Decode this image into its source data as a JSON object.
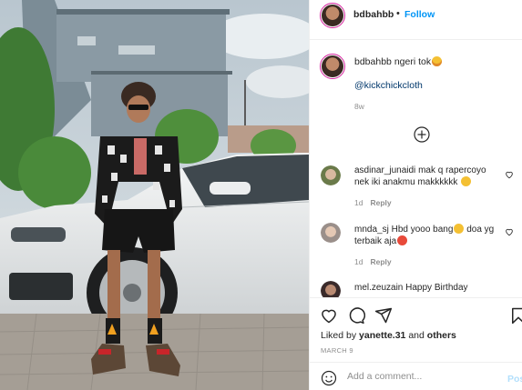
{
  "header": {
    "username": "bdbahbb",
    "separator": "•",
    "follow_label": "Follow"
  },
  "caption": {
    "username": "bdbahbb",
    "text": "ngeri tok",
    "mention": "@kickchickcloth",
    "age": "8w"
  },
  "load_more_icon": "plus-circle-icon",
  "comments": [
    {
      "username": "asdinar_junaidi",
      "text": "mak q rapercoyo nek iki anakmu makkkkkk",
      "age": "1d",
      "reply_label": "Reply"
    },
    {
      "username": "mnda_sj",
      "text": "Hbd yooo bang",
      "text2": "doa yg terbaik aja",
      "age": "1d",
      "reply_label": "Reply"
    },
    {
      "username": "mel.zeuzain",
      "text": "Happy Birthday"
    }
  ],
  "actions": {
    "icons": [
      "heart-icon",
      "comment-icon",
      "share-icon",
      "bookmark-icon"
    ],
    "liked_prefix": "Liked by",
    "liked_user": "yanette.31",
    "liked_suffix": "and",
    "liked_others": "others",
    "date": "MARCH 9"
  },
  "add_comment": {
    "placeholder": "Add a comment...",
    "post_label": "Post"
  },
  "colors": {
    "accent": "#0095f6",
    "mention": "#00376b",
    "muted": "#8e8e8e",
    "post_disabled": "#b2dffc"
  }
}
